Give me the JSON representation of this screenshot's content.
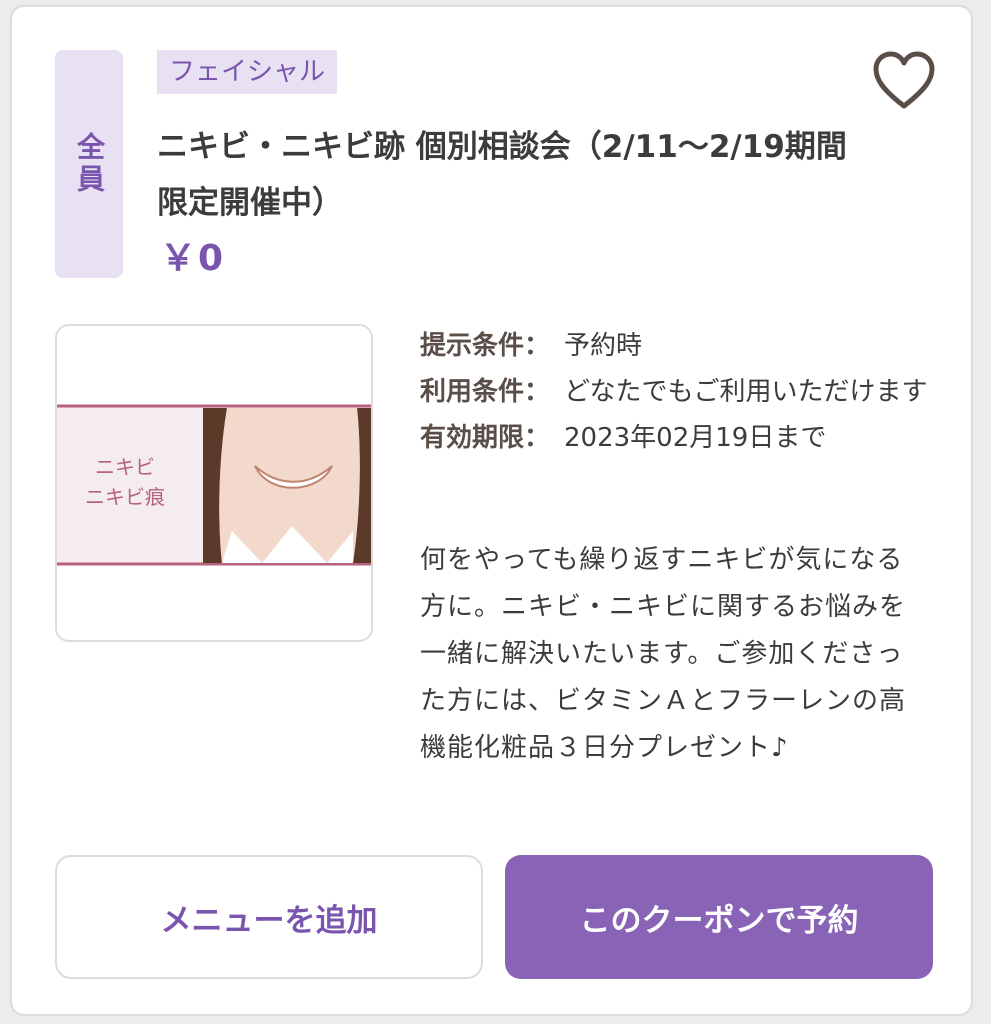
{
  "coupon": {
    "target_badge": "全員",
    "category": "フェイシャル",
    "title": "ニキビ・ニキビ跡 個別相談会（2/11〜2/19期間限定開催中）",
    "price": "￥0",
    "image_caption_line1": "ニキビ",
    "image_caption_line2": "ニキビ痕",
    "conditions": [
      {
        "label": "提示条件：",
        "value": "予約時"
      },
      {
        "label": "利用条件：",
        "value": "どなたでもご利用いただけます"
      },
      {
        "label": "有効期限：",
        "value": "2023年02月19日まで"
      }
    ],
    "description": "何をやっても繰り返すニキビが気になる方に。ニキビ・ニキビに関するお悩みを一緒に解決いたいます。ご参加くださった方には、ビタミンＡとフラーレンの高機能化粧品３日分プレゼント♪"
  },
  "actions": {
    "add_menu_label": "メニューを追加",
    "reserve_label": "このクーポンで予約"
  },
  "icons": {
    "favorite": "heart-outline-icon"
  },
  "colors": {
    "accent": "#8863b6",
    "accent_text": "#7a55ad",
    "tag_bg": "#e8e0f3",
    "border": "#dcdcdc"
  }
}
